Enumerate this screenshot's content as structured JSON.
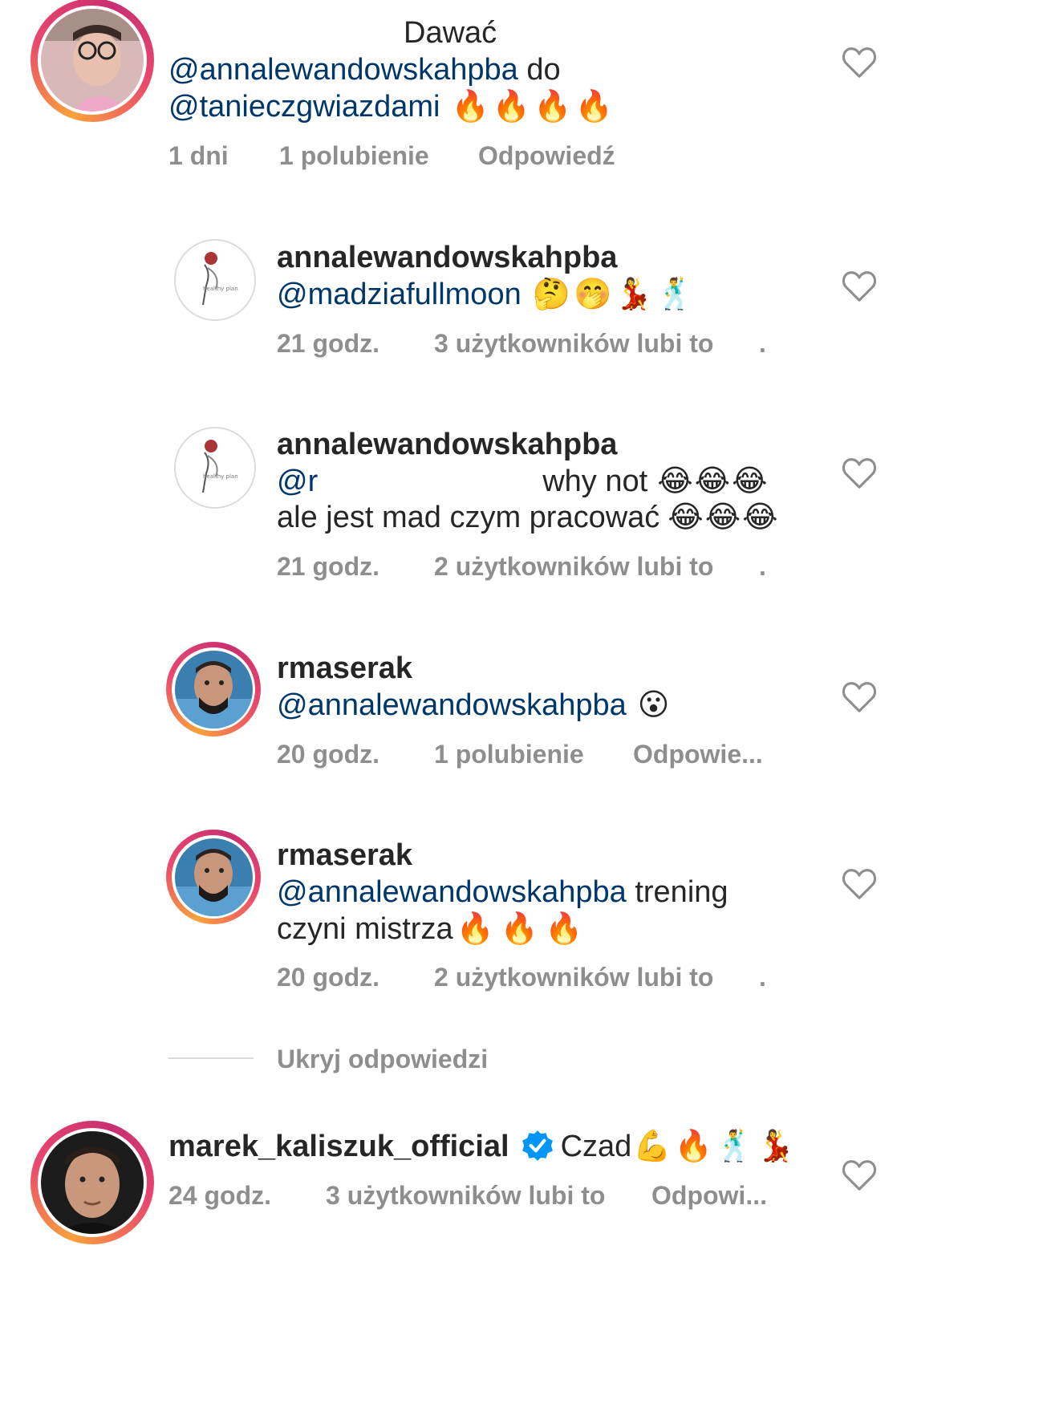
{
  "comments": [
    {
      "line_top": "Dawać",
      "line1_mention": "@annalewandowskahpba",
      "line1_text": " do",
      "line2_mention": "@tanieczgwiazdami",
      "emojis": "🔥🔥🔥🔥",
      "time": "1 dni",
      "likes": "1 polubienie",
      "reply": "Odpowiedź"
    },
    {
      "username": "annalewandowskahpba",
      "mention": "@madziafullmoon",
      "emojis": "🤔🤭💃🕺",
      "time": "21 godz.",
      "likes": "3 użytkowników lubi to",
      "dot": "."
    },
    {
      "username": "annalewandowskahpba",
      "mention_partial": "@r",
      "text_after": "why not",
      "emojis_1": "😂😂😂",
      "line2": "ale jest mad czym pracować",
      "emojis_2": "😂😂😂",
      "time": "21 godz.",
      "likes": "2 użytkowników lubi to",
      "dot": "."
    },
    {
      "username": "rmaserak",
      "mention": "@annalewandowskahpba",
      "emojis": "😮",
      "time": "20 godz.",
      "likes": "1 polubienie",
      "reply": "Odpowie..."
    },
    {
      "username": "rmaserak",
      "mention": "@annalewandowskahpba",
      "text_after": " trening",
      "line2": "czyni mistrza",
      "emojis": "🔥🔥🔥",
      "time": "20 godz.",
      "likes": "2 użytkowników lubi to",
      "dot": "."
    },
    {
      "username": "marek_kaliszuk_official",
      "text": "Czad",
      "emojis": "💪🔥🕺💃",
      "time": "24 godz.",
      "likes": "3 użytkowników lubi to",
      "reply": "Odpowi..."
    }
  ],
  "hide_replies": "Ukryj odpowiedzi",
  "icons": {
    "like": "heart-outline-icon",
    "verified": "verified-badge-icon"
  },
  "colors": {
    "mention": "#00376b",
    "meta": "#8e8e8e",
    "verified": "#0095f6"
  }
}
